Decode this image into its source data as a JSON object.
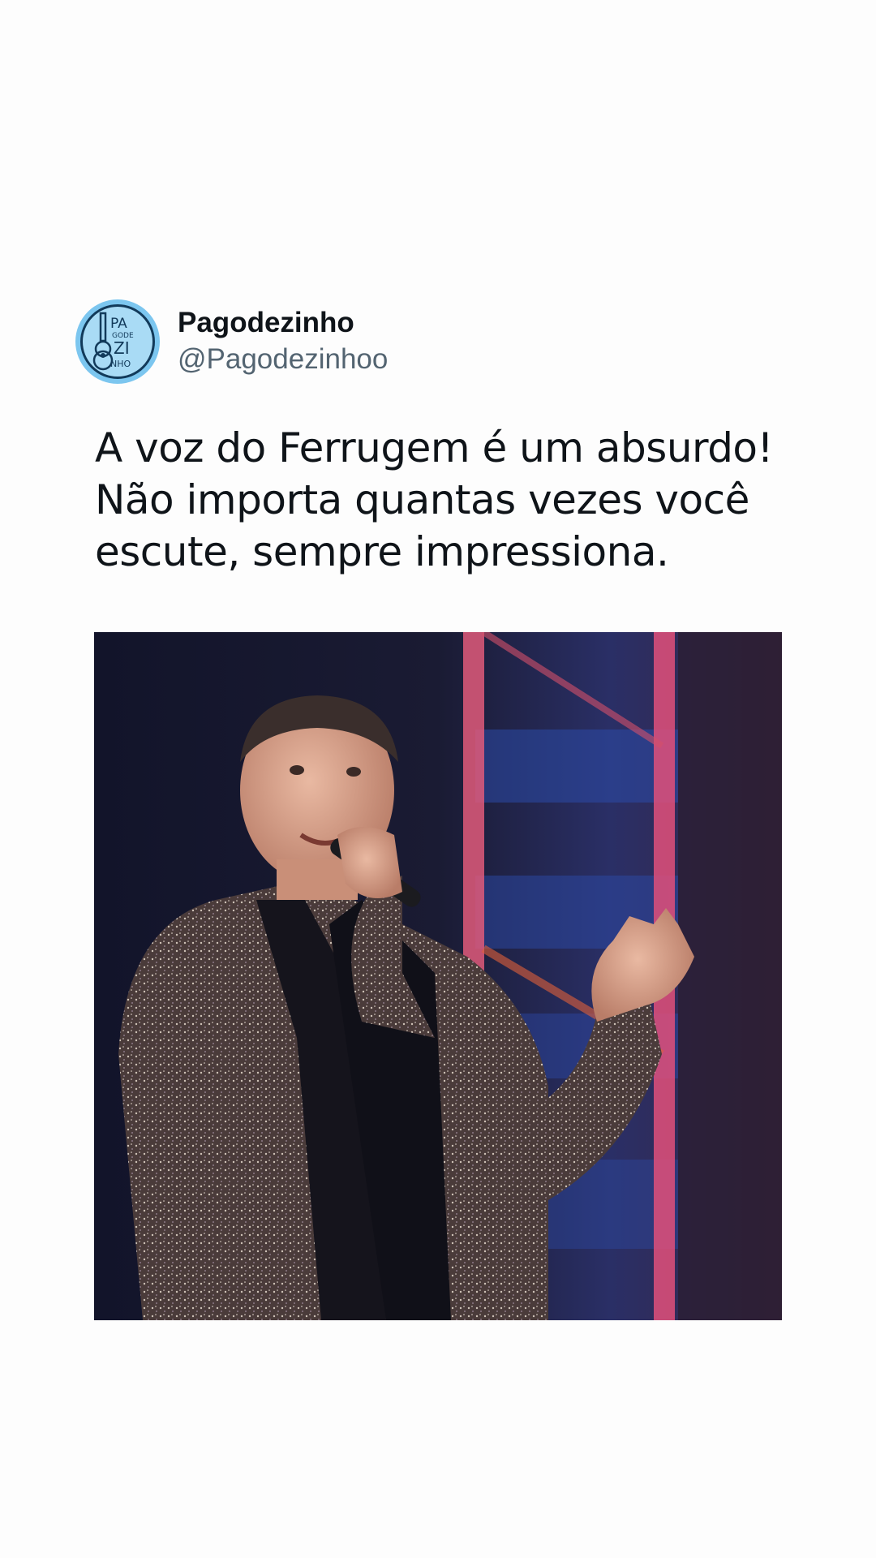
{
  "post": {
    "author": {
      "display_name": "Pagodezinho",
      "handle": "@Pagodezinhoo",
      "avatar": {
        "icon": "guitar-logo-icon",
        "logo_lines": [
          "PA",
          "GODE",
          "ZI",
          "NHO"
        ]
      }
    },
    "text": "A voz do Ferrugem é um absurdo!\nNão importa quantas vezes você\nescute, sempre impressiona.",
    "media": {
      "type": "photo",
      "subject": "singer-performing-photo"
    }
  },
  "colors": {
    "background": "#fdfdfd",
    "text_primary": "#0f1419",
    "text_secondary": "#536471",
    "avatar_bg": "#7cc6ef"
  }
}
